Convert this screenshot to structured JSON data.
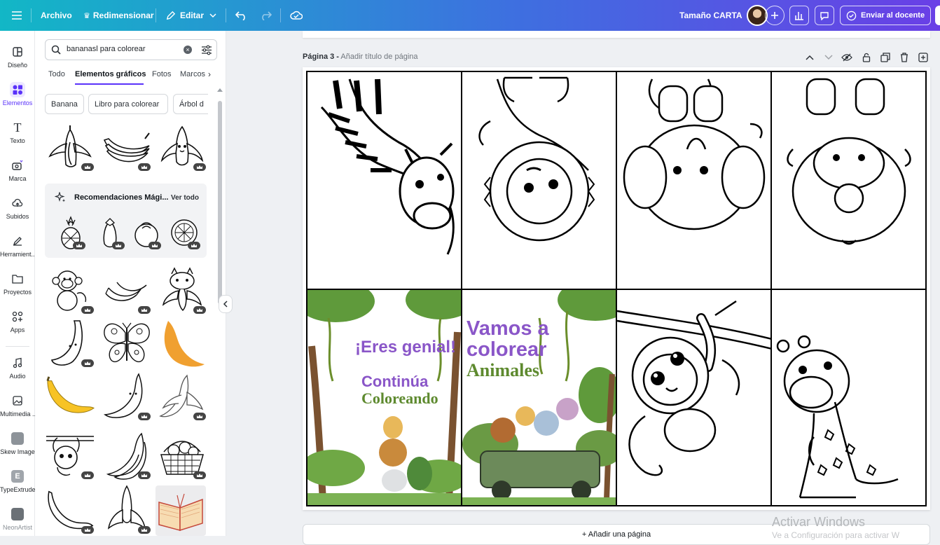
{
  "topbar": {
    "file_label": "Archivo",
    "resize_label": "Redimensionar",
    "edit_label": "Editar",
    "size_label": "Tamaño CARTA",
    "send_label": "Enviar al docente"
  },
  "rail": {
    "items": [
      {
        "label": "Diseño",
        "icon": "layout-icon"
      },
      {
        "label": "Elementos",
        "icon": "elements-icon"
      },
      {
        "label": "Texto",
        "icon": "text-icon"
      },
      {
        "label": "Marca",
        "icon": "brand-icon"
      },
      {
        "label": "Subidos",
        "icon": "upload-icon"
      },
      {
        "label": "Herramient...",
        "icon": "tools-icon"
      },
      {
        "label": "Proyectos",
        "icon": "folder-icon"
      },
      {
        "label": "Apps",
        "icon": "apps-icon"
      },
      {
        "label": "Audio",
        "icon": "music-icon"
      },
      {
        "label": "Multimedia ...",
        "icon": "media-icon"
      },
      {
        "label": "Skew Image",
        "icon": "skew-app-icon"
      },
      {
        "label": "TypeExtrude",
        "icon": "typeextrude-app-icon"
      },
      {
        "label": "NeonArtist",
        "icon": "neonartist-app-icon"
      }
    ]
  },
  "panel": {
    "search_value": "bananasl para colorear",
    "tabs": [
      "Todo",
      "Elementos gráficos",
      "Fotos",
      "Marcos"
    ],
    "chips": [
      "Banana",
      "Libro para colorear",
      "Árbol d"
    ],
    "magic_title": "Recomendaciones Mági...",
    "magic_see_all": "Ver todo"
  },
  "canvas": {
    "page_label": "Página 3 -",
    "page_title_placeholder": "Añadir título de página",
    "add_page_label": "+ Añadir una página",
    "card1_line1": "¡Eres genial!",
    "card1_line2": "Continúa",
    "card1_line3": "Coloreando",
    "card2_line1": "Vamos a",
    "card2_line2": "colorear",
    "card2_line3": "Animales"
  },
  "watermark": {
    "title": "Activar Windows",
    "subtitle": "Ve a Configuración para activar W"
  },
  "colors": {
    "accent": "#5a32fa",
    "purple_text": "#8a56c8",
    "green_text": "#5e8a2f",
    "banana_yellow": "#f7c325",
    "banana_orange": "#f0a030"
  }
}
